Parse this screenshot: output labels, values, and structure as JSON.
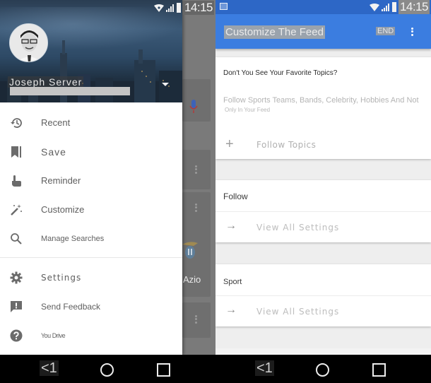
{
  "left_screen": {
    "status_bar": {
      "time": "14:15",
      "icons": [
        "wifi-icon",
        "signal-icon",
        "battery-icon"
      ]
    },
    "drawer": {
      "user": {
        "name": "Joseph Server",
        "email_redacted": true
      },
      "menu_primary": [
        {
          "icon": "history-icon",
          "label": "Recent"
        },
        {
          "icon": "bookmark-icon",
          "label": "Save"
        },
        {
          "icon": "reminder-hand-icon",
          "label": "Reminder"
        },
        {
          "icon": "magic-wand-icon",
          "label": "Customize"
        },
        {
          "icon": "search-icon",
          "label": "Manage Searches"
        }
      ],
      "menu_secondary": [
        {
          "icon": "gear-icon",
          "label": "Settings"
        },
        {
          "icon": "feedback-icon",
          "label": "Send Feedback"
        },
        {
          "icon": "help-icon",
          "label": "You Drive"
        }
      ]
    },
    "background_app": {
      "visible_label": "Azio"
    },
    "nav_bar": {
      "back_label": "<1"
    }
  },
  "right_screen": {
    "status_bar": {
      "time": "14:15"
    },
    "app_bar": {
      "title": "Customize The Feed",
      "action_label": "END"
    },
    "topics_card": {
      "title": "Don't You See Your Favorite Topics?",
      "description_line1": "Follow Sports Teams, Bands, Celebrity, Hobbies And Not",
      "description_line2": "Only In Your Feed",
      "action_label": "Follow Topics",
      "action_icon": "+"
    },
    "sections": [
      {
        "title": "Follow",
        "action_label": "View All Settings",
        "action_icon": "→"
      },
      {
        "title": "Sport",
        "action_label": "View All Settings",
        "action_icon": "→"
      }
    ],
    "nav_bar": {
      "back_label": "<1"
    }
  },
  "colors": {
    "app_bar": "#3b7de0",
    "status_bar_right": "#2d67c6",
    "drawer_bg": "#ffffff",
    "icon_gray": "#6b6b6b",
    "page_bg": "#eeeeee"
  }
}
